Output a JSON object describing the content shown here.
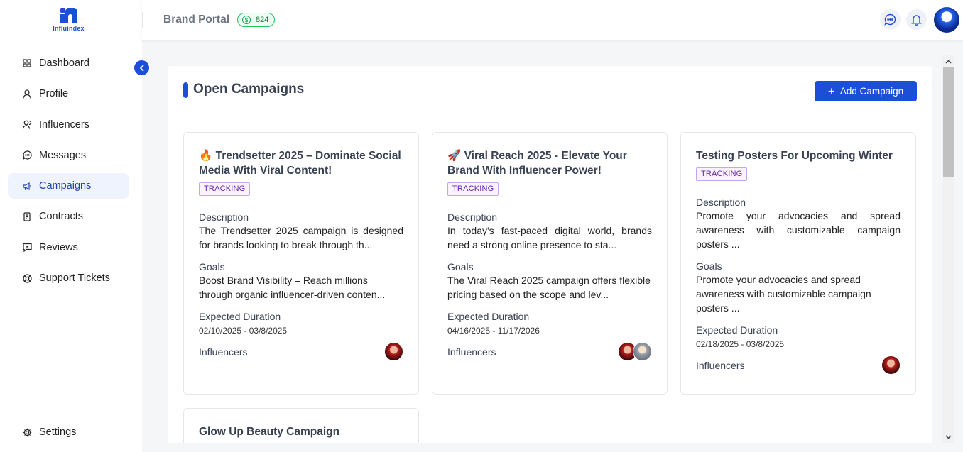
{
  "app": {
    "logo_text": "Influindex",
    "brand_title": "Brand Portal",
    "credits": "824"
  },
  "sidebar": {
    "items": [
      {
        "label": "Dashboard",
        "icon": "grid-icon"
      },
      {
        "label": "Profile",
        "icon": "user-icon"
      },
      {
        "label": "Influencers",
        "icon": "users-icon"
      },
      {
        "label": "Messages",
        "icon": "chat-icon"
      },
      {
        "label": "Campaigns",
        "icon": "megaphone-icon",
        "active": true
      },
      {
        "label": "Contracts",
        "icon": "document-icon"
      },
      {
        "label": "Reviews",
        "icon": "review-icon"
      },
      {
        "label": "Support Tickets",
        "icon": "support-icon"
      }
    ],
    "settings_label": "Settings"
  },
  "main": {
    "title": "Open Campaigns",
    "add_button_label": "Add Campaign",
    "section_labels": {
      "description": "Description",
      "goals": "Goals",
      "duration": "Expected Duration",
      "influencers": "Influencers"
    },
    "campaigns": [
      {
        "title": "🔥 Trendsetter 2025 – Dominate Social Media With Viral Content!",
        "status": "TRACKING",
        "description": "The Trendsetter 2025 campaign is designed for brands looking to break through th...",
        "goals": "Boost Brand Visibility – Reach millions through organic influencer-driven conten...",
        "duration": "02/10/2025 - 03/8/2025",
        "influencer_count": 1
      },
      {
        "title": "🚀 Viral Reach 2025 - Elevate Your Brand With Influencer Power!",
        "status": "TRACKING",
        "description": "In today's fast-paced digital world, brands need a strong online presence to sta...",
        "goals": "The Viral Reach 2025 campaign offers flexible pricing based on the scope and lev...",
        "duration": "04/16/2025 - 11/17/2026",
        "influencer_count": 2
      },
      {
        "title": "Testing Posters For Upcoming Winter",
        "status": "TRACKING",
        "description": "Promote your advocacies and spread awareness with customizable campaign posters ...",
        "goals": "Promote your advocacies and spread awareness with customizable campaign posters ...",
        "duration": "02/18/2025 - 03/8/2025",
        "influencer_count": 1
      },
      {
        "title": "Glow Up Beauty Campaign"
      }
    ]
  },
  "colors": {
    "primary": "#1d4ed8",
    "active_bg": "#eef3fd",
    "tag_border": "#c4a6e9",
    "credits_green": "#22c55e"
  }
}
